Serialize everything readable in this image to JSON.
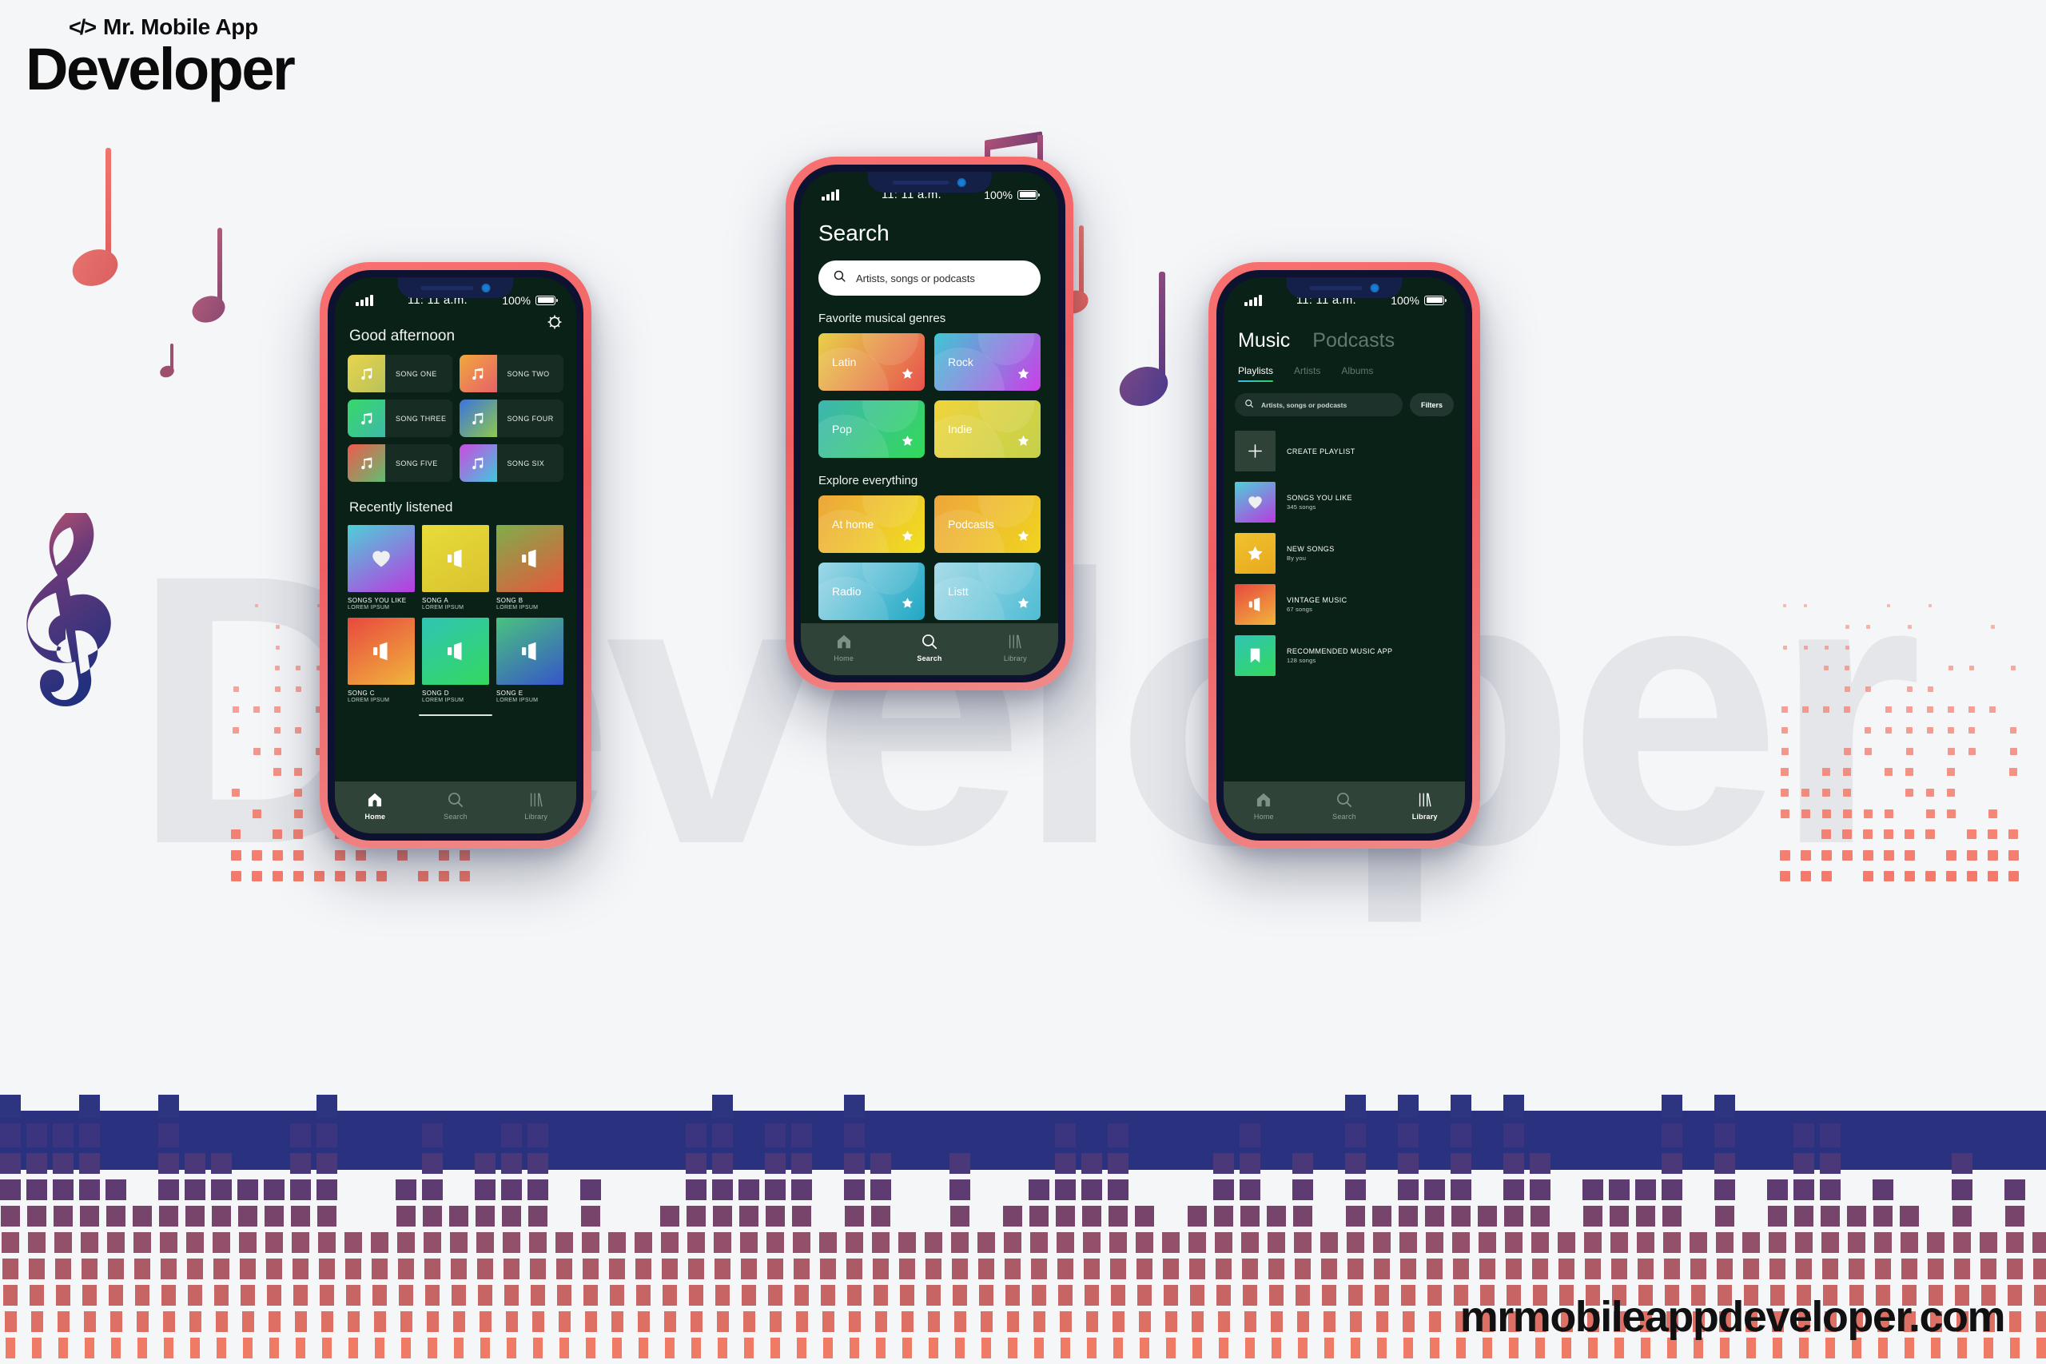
{
  "brand": {
    "code_glyph": "</>",
    "top_line": "Mr. Mobile App",
    "main_line": "Developer",
    "ghost_word": "Developer",
    "website": "mrmobileappdeveloper.com",
    "accent_coral": "#ef5f62",
    "accent_navy": "#2a3280",
    "accent_purple": "#4a2a6b",
    "screen_bg": "#0a2118"
  },
  "status_bar": {
    "signal_icon": "signal-bars-icon",
    "time": "11: 11 a.m.",
    "battery_percent": "100%",
    "battery_icon": "battery-full-icon"
  },
  "bottom_nav": {
    "items": [
      {
        "label": "Home",
        "icon": "home-icon"
      },
      {
        "label": "Search",
        "icon": "search-icon"
      },
      {
        "label": "Library",
        "icon": "library-icon"
      }
    ]
  },
  "home_screen": {
    "settings_icon": "gear-icon",
    "greeting": "Good afternoon",
    "active_tab": "Home",
    "songs": [
      {
        "name": "SONG ONE",
        "icon": "music-note-icon",
        "c1": "#e8d44d",
        "c2": "#b9c25a"
      },
      {
        "name": "SONG TWO",
        "icon": "music-note-icon",
        "c1": "#f0a93c",
        "c2": "#e85f6a"
      },
      {
        "name": "SONG THREE",
        "icon": "music-note-icon",
        "c1": "#36d96a",
        "c2": "#3fb9a8"
      },
      {
        "name": "SONG FOUR",
        "icon": "music-note-icon",
        "c1": "#3b73e0",
        "c2": "#8ec94a"
      },
      {
        "name": "SONG FIVE",
        "icon": "music-note-icon",
        "c1": "#ef5a4c",
        "c2": "#5fbf72"
      },
      {
        "name": "SONG SIX",
        "icon": "music-note-icon",
        "c1": "#cc4ae0",
        "c2": "#3fc9dd"
      }
    ],
    "recent_section_title": "Recently listened",
    "recent": [
      {
        "title": "SONGS YOU LIKE",
        "sub": "LOREM IPSUM",
        "icon": "heart-icon",
        "c1": "#4ecfd8",
        "c2": "#b93ae0"
      },
      {
        "title": "SONG A",
        "sub": "LOREM IPSUM",
        "icon": "speaker-icon",
        "c1": "#e8dc3a",
        "c2": "#d9c22e"
      },
      {
        "title": "SONG B",
        "sub": "LOREM IPSUM",
        "icon": "speaker-icon",
        "c1": "#7fae4a",
        "c2": "#e8563c"
      },
      {
        "title": "SONG C",
        "sub": "LOREM IPSUM",
        "icon": "speaker-icon",
        "c1": "#e8483f",
        "c2": "#f0b63c"
      },
      {
        "title": "SONG D",
        "sub": "LOREM IPSUM",
        "icon": "speaker-icon",
        "c1": "#2fc4b5",
        "c2": "#33d95e"
      },
      {
        "title": "SONG E",
        "sub": "LOREM IPSUM",
        "icon": "speaker-icon",
        "c1": "#4ac27f",
        "c2": "#3655c9"
      }
    ]
  },
  "search_screen": {
    "title": "Search",
    "search_icon": "search-icon",
    "search_placeholder": "Artists, songs or podcasts",
    "search_value": "",
    "active_tab": "Search",
    "genres_title": "Favorite musical genres",
    "genres": [
      {
        "name": "Latin",
        "star": "star-icon",
        "c1": "#e8d14a",
        "c2": "#e8524f"
      },
      {
        "name": "Rock",
        "star": "star-icon",
        "c1": "#3fc8d4",
        "c2": "#cc3fe8"
      },
      {
        "name": "Pop",
        "star": "star-icon",
        "c1": "#3fb5b0",
        "c2": "#33d95a"
      },
      {
        "name": "Indie",
        "star": "star-icon",
        "c1": "#f0d43c",
        "c2": "#c4d14a"
      }
    ],
    "explore_title": "Explore everything",
    "explore": [
      {
        "name": "At home",
        "star": "star-icon",
        "c1": "#eda63c",
        "c2": "#f0e01e"
      },
      {
        "name": "Podcasts",
        "star": "star-icon",
        "c1": "#eda63c",
        "c2": "#f0d41e"
      },
      {
        "name": "Radio",
        "star": "star-icon",
        "c1": "#9fd8e8",
        "c2": "#1fa8c4"
      },
      {
        "name": "Listt",
        "star": "star-icon",
        "c1": "#a8dce8",
        "c2": "#4fbcd4"
      }
    ]
  },
  "library_screen": {
    "heading_active": "Music",
    "heading_inactive": "Podcasts",
    "active_tab": "Library",
    "tabs": [
      {
        "label": "Playlists",
        "active": true
      },
      {
        "label": "Artists",
        "active": false
      },
      {
        "label": "Albums",
        "active": false
      }
    ],
    "search_icon": "search-icon",
    "search_placeholder": "Artists, songs or podcasts",
    "filters_label": "Filters",
    "playlists": [
      {
        "title": "CREATE PLAYLIST",
        "sub": "",
        "icon": "plus-icon",
        "c1": "#2e4238",
        "c2": "#2e4238"
      },
      {
        "title": "SONGS YOU LIKE",
        "sub": "345 songs",
        "icon": "heart-icon",
        "c1": "#4ecfd8",
        "c2": "#b93ae0"
      },
      {
        "title": "NEW SONGS",
        "sub": "By you",
        "icon": "star-icon",
        "c1": "#f0c32e",
        "c2": "#e8a81e"
      },
      {
        "title": "VINTAGE MUSIC",
        "sub": "67 songs",
        "icon": "speaker-icon",
        "c1": "#e8483f",
        "c2": "#f0b63c"
      },
      {
        "title": "RECOMMENDED MUSIC APP",
        "sub": "128 songs",
        "icon": "bookmark-icon",
        "c1": "#2fc4b5",
        "c2": "#33d95e"
      }
    ]
  },
  "decor": {
    "notes": [
      "quarter-note-icon",
      "quarter-note-icon",
      "beamed-notes-icon",
      "quarter-note-icon",
      "quarter-note-icon"
    ],
    "clef": "treble-clef-icon",
    "equalizer": "equalizer-bars-decoration"
  }
}
